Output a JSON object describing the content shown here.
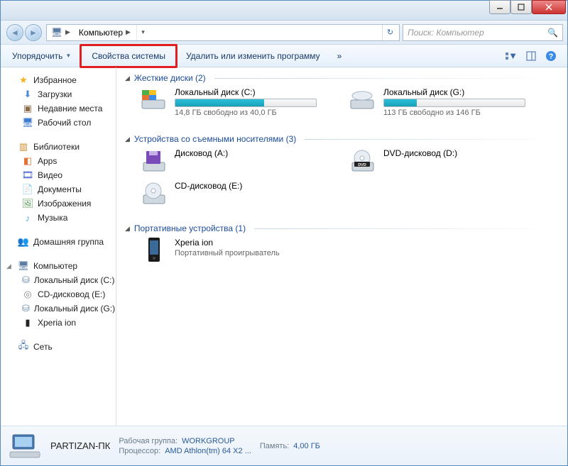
{
  "address": {
    "root": "Компьютер"
  },
  "search": {
    "placeholder": "Поиск: Компьютер"
  },
  "toolbar": {
    "organize": "Упорядочить",
    "system_props": "Свойства системы",
    "uninstall": "Удалить или изменить программу",
    "overflow": "»"
  },
  "sidebar": {
    "favorites": {
      "label": "Избранное",
      "items": [
        {
          "label": "Загрузки"
        },
        {
          "label": "Недавние места"
        },
        {
          "label": "Рабочий стол"
        }
      ]
    },
    "libraries": {
      "label": "Библиотеки",
      "items": [
        {
          "label": "Apps"
        },
        {
          "label": "Видео"
        },
        {
          "label": "Документы"
        },
        {
          "label": "Изображения"
        },
        {
          "label": "Музыка"
        }
      ]
    },
    "homegroup": {
      "label": "Домашняя группа"
    },
    "computer": {
      "label": "Компьютер",
      "items": [
        {
          "label": "Локальный диск (C:)"
        },
        {
          "label": "CD-дисковод (E:)"
        },
        {
          "label": "Локальный диск (G:)"
        },
        {
          "label": "Xperia ion"
        }
      ]
    },
    "network": {
      "label": "Сеть"
    }
  },
  "sections": [
    {
      "title": "Жесткие диски (2)",
      "drives": [
        {
          "name": "Локальный диск (C:)",
          "free_text": "14,8 ГБ свободно из 40,0 ГБ",
          "fill_pct": 63,
          "kind": "hdd_win"
        },
        {
          "name": "Локальный диск (G:)",
          "free_text": "113 ГБ свободно из 146 ГБ",
          "fill_pct": 23,
          "kind": "hdd"
        }
      ]
    },
    {
      "title": "Устройства со съемными носителями (3)",
      "drives": [
        {
          "name": "Дисковод (A:)",
          "kind": "floppy"
        },
        {
          "name": "DVD-дисковод (D:)",
          "kind": "dvd"
        },
        {
          "name": "CD-дисковод (E:)",
          "kind": "cd"
        }
      ]
    },
    {
      "title": "Портативные устройства (1)",
      "drives": [
        {
          "name": "Xperia ion",
          "sub": "Портативный проигрыватель",
          "kind": "phone"
        }
      ]
    }
  ],
  "details": {
    "name": "PARTIZAN-ПК",
    "workgroup_label": "Рабочая группа:",
    "workgroup": "WORKGROUP",
    "cpu_label": "Процессор:",
    "cpu": "AMD Athlon(tm) 64 X2 ...",
    "mem_label": "Память:",
    "mem": "4,00 ГБ"
  }
}
